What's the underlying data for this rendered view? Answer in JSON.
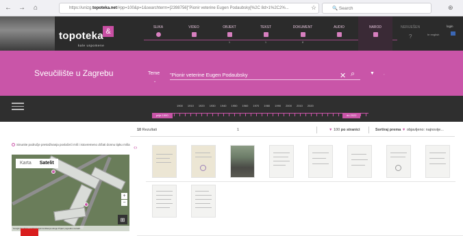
{
  "browser": {
    "url_prefix": "https://unizg.",
    "url_domain": "topoteka.net",
    "url_rest": "/#pp=100&p=1&searchterm=[2398756]\"Pionir veterine Eugen Podaubsky[%2C 8d>1%2C2%...",
    "search_placeholder": "Search"
  },
  "logo": {
    "name": "topoteka",
    "badge": "&",
    "subtitle": "kale uspomene"
  },
  "categories": [
    {
      "label": "SLIKA",
      "count": ""
    },
    {
      "label": "VIDEO",
      "count": ""
    },
    {
      "label": "OBJEKT",
      "count": "1"
    },
    {
      "label": "TEKST",
      "count": "1"
    },
    {
      "label": "DOKUMENT",
      "count": "8"
    },
    {
      "label": "AUDIO",
      "count": ""
    },
    {
      "label": "NAROD",
      "count": ""
    }
  ],
  "header_right": {
    "nerijesen": "NERIJEŠEN",
    "login": "login",
    "lang": "hr english"
  },
  "banner": {
    "university": "Sveučilište u Zagrebu",
    "teme": "Teme",
    "query": "\"Pionir veterine Eugen Podaubsky"
  },
  "timeline": {
    "years": [
      "1900",
      "1910",
      "1920",
      "1930",
      "1940",
      "1950",
      "1960",
      "1970",
      "1980",
      "1990",
      "2000",
      "2010",
      "2020"
    ],
    "start_label": "prije 1900",
    "end_label": "do 2022"
  },
  "results": {
    "count": "10",
    "count_label": "Rezultati",
    "page": "1",
    "per_page": "100",
    "per_page_label": "po stranici",
    "sort_label": "Sortiraj prema",
    "sort_value": "objavljeno: najnovije..."
  },
  "map": {
    "note": "Sinunite područje pretraživanja povlačeći miš i istovremeno držati donnu tipku miša",
    "tab_map": "Karta",
    "tab_sat": "Satelit",
    "footer": "Google  Ssodkate podatci  Uvjeti korištenja usluge  Prijavi pogrešku na karti"
  },
  "colors": {
    "brand_pink": "#c955a8",
    "header_dark": "#2b2b2b",
    "timeline_dark": "#2f2f2f"
  }
}
